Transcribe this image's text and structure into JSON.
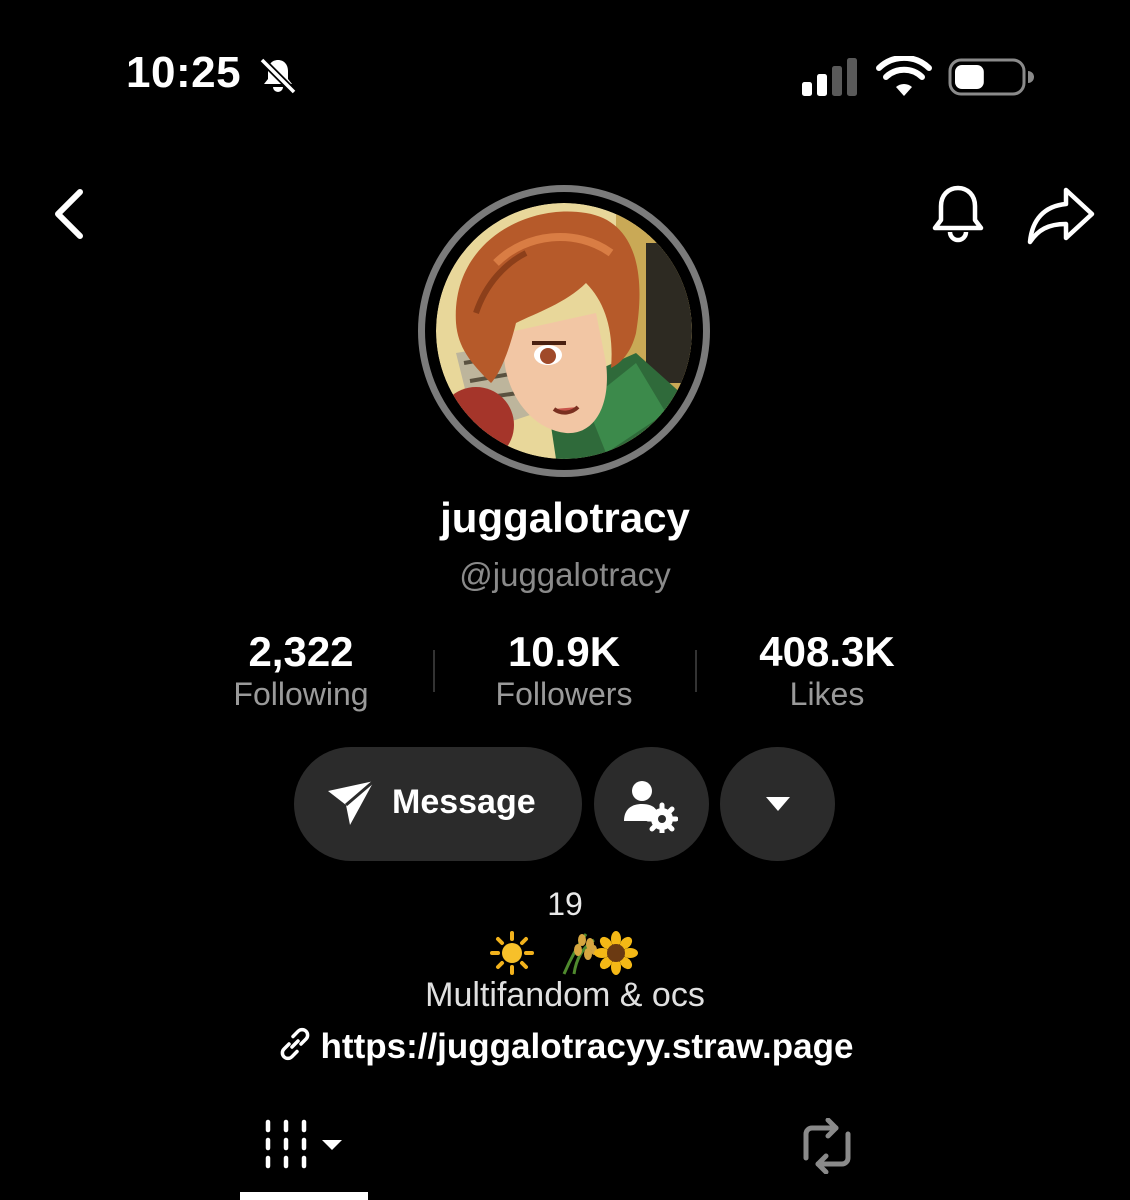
{
  "status_bar": {
    "time": "10:25",
    "silent_icon": "bell-slash-icon",
    "signal_icon": "cellular-signal-icon",
    "wifi_icon": "wifi-icon",
    "battery_icon": "battery-icon",
    "battery_level": 0.45
  },
  "nav": {
    "back_icon": "chevron-left-icon",
    "notifications_icon": "bell-icon",
    "share_icon": "share-arrow-icon"
  },
  "profile": {
    "avatar_icon": "avatar-image",
    "display_name": "juggalotracy",
    "handle": "@juggalotracy"
  },
  "stats": [
    {
      "value": "2,322",
      "label": "Following"
    },
    {
      "value": "10.9K",
      "label": "Followers"
    },
    {
      "value": "408.3K",
      "label": "Likes"
    }
  ],
  "actions": {
    "message_label": "Message",
    "message_icon": "send-icon",
    "person_settings_icon": "person-gear-icon",
    "more_icon": "caret-down-icon"
  },
  "bio": {
    "age": "19",
    "emojis": "☀️🌾🌻",
    "text": "Multifandom & ocs",
    "link_icon": "link-icon",
    "link": "https://juggalotracyy.straw.page"
  },
  "tabs": {
    "videos_icon": "grid-videos-icon",
    "reposts_icon": "repost-icon"
  },
  "colors": {
    "background": "#000000",
    "button_bg": "#2b2b2b",
    "secondary_text": "#8a8a8a",
    "avatar_ring": "#7b7b7b"
  }
}
